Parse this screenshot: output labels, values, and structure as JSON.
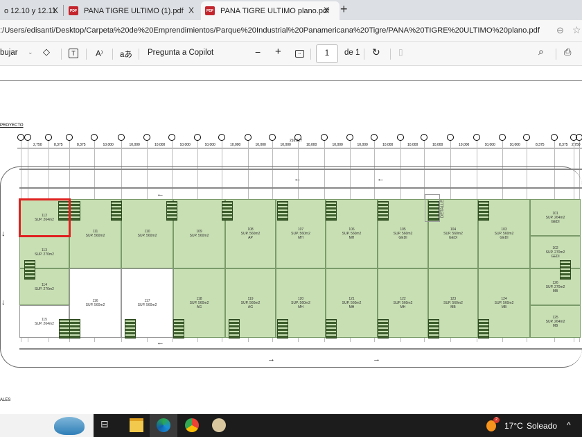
{
  "browser": {
    "tabs": [
      {
        "title": "o 12.10 y 12.11.",
        "active": false
      },
      {
        "title": "PANA TIGRE ULTIMO (1).pdf",
        "active": false
      },
      {
        "title": "PANA TIGRE ULTIMO plano.pdf",
        "active": true
      }
    ],
    "close_glyph": "X",
    "new_tab": "+",
    "url": ":/Users/edisanti/Desktop/Carpeta%20de%20Emprendimientos/Parque%20Industrial%20Panamericana%20Tigre/PANA%20TIGRE%20ULTIMO%20plano.pdf",
    "pdf_badge": "PDF"
  },
  "toolbar": {
    "draw_label": "bujar",
    "copilot_label": "Pregunta a Copilot",
    "zoom_out": "−",
    "zoom_in": "+",
    "page_current": "1",
    "page_total": "de 1",
    "read_aloud": "A⁾",
    "translate": "aあ"
  },
  "plan": {
    "section_title": "PROYECTO",
    "footer_title": "ALES",
    "total_dim": "216,627",
    "detail_label": "DETALLE",
    "dims": [
      "2,750",
      "8,375",
      "8,375",
      "10,000",
      "10,000",
      "10,000",
      "10,000",
      "10,000",
      "10,000",
      "10,000",
      "10,000",
      "10,000",
      "10,000",
      "10,000",
      "10,000",
      "10,000",
      "10,000",
      "10,000",
      "10,000",
      "10,000",
      "8,375",
      "8,375",
      "2,750"
    ],
    "selected_unit": "112",
    "units": [
      {
        "id": "112",
        "area": "SUP. 264m2",
        "use": ""
      },
      {
        "id": "113",
        "area": "SUP. 270m2",
        "use": ""
      },
      {
        "id": "114",
        "area": "SUP. 270m2",
        "use": ""
      },
      {
        "id": "115",
        "area": "SUP. 264m2",
        "use": ""
      },
      {
        "id": "111",
        "area": "SUP. 560m2",
        "use": ""
      },
      {
        "id": "110",
        "area": "SUP. 560m2",
        "use": ""
      },
      {
        "id": "109",
        "area": "SUP. 560m2",
        "use": ""
      },
      {
        "id": "108",
        "area": "SUP. 560m2",
        "use": "AP"
      },
      {
        "id": "107",
        "area": "SUP. 560m2",
        "use": "MH"
      },
      {
        "id": "106",
        "area": "SUP. 560m2",
        "use": "MH"
      },
      {
        "id": "105",
        "area": "SUP. 560m2",
        "use": "GEDI"
      },
      {
        "id": "104",
        "area": "SUP. 560m2",
        "use": "GEDI"
      },
      {
        "id": "103",
        "area": "SUP. 560m2",
        "use": "GEDI"
      },
      {
        "id": "116",
        "area": "SUP. 560m2",
        "use": ""
      },
      {
        "id": "117",
        "area": "SUP. 560m2",
        "use": ""
      },
      {
        "id": "118",
        "area": "SUP. 560m2",
        "use": "AG"
      },
      {
        "id": "119",
        "area": "SUP. 560m2",
        "use": "AG"
      },
      {
        "id": "120",
        "area": "SUP. 560m2",
        "use": "MH"
      },
      {
        "id": "121",
        "area": "SUP. 560m2",
        "use": "MH"
      },
      {
        "id": "122",
        "area": "SUP. 560m2",
        "use": "MH"
      },
      {
        "id": "123",
        "area": "SUP. 560m2",
        "use": "MB"
      },
      {
        "id": "124",
        "area": "SUP. 560m2",
        "use": "MB"
      },
      {
        "id": "101",
        "area": "SUP. 264m2",
        "use": "GEDI"
      },
      {
        "id": "102",
        "area": "SUP. 270m2",
        "use": "GEDI"
      },
      {
        "id": "126",
        "area": "SUP. 270m2",
        "use": "MB"
      },
      {
        "id": "125",
        "area": "SUP. 264m2",
        "use": "MB"
      }
    ],
    "colors": {
      "green": "#c8dfb4",
      "highlight": "#e02020"
    }
  },
  "taskbar": {
    "weather_temp": "17°C",
    "weather_text": "Soleado",
    "weather_badge": "2",
    "caret": "^"
  }
}
